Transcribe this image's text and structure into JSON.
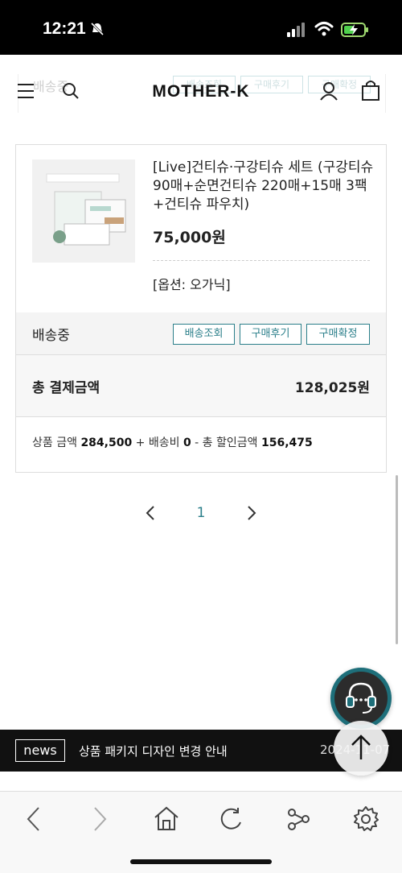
{
  "status_bar": {
    "time": "12:21"
  },
  "header": {
    "logo": "MOTHER-K",
    "ghost_shipping_label": "배송중",
    "ghost_buttons": [
      "배송조회",
      "구매후기",
      "구매확정"
    ]
  },
  "order": {
    "product_name": "[Live]건티슈·구강티슈 세트 (구강티슈 90매+순면건티슈 220매+15매 3팩+건티슈 파우치)",
    "price": "75,000원",
    "option": "[옵션: 오가닉]",
    "shipping_status": "배송중",
    "buttons": {
      "track": "배송조회",
      "review": "구매후기",
      "confirm": "구매확정"
    },
    "total_label": "총 결제금액",
    "total_value": "128,025원",
    "breakdown": {
      "product_label": "상품 금액",
      "product_value": "284,500",
      "plus": "+",
      "shipping_label": "배송비",
      "shipping_value": "0",
      "minus": "-",
      "discount_label": "총 할인금액",
      "discount_value": "156,475"
    }
  },
  "pagination": {
    "current": "1"
  },
  "news": {
    "badge": "news",
    "text": "상품 패키지 디자인 변경 안내",
    "date": "2024-11-07"
  },
  "colors": {
    "accent": "#2b7f8a",
    "news_bg": "#111111",
    "status_bar": "#000000"
  },
  "icons": [
    "menu-icon",
    "search-icon",
    "user-icon",
    "bag-icon",
    "headset-icon",
    "arrow-up-icon",
    "back-icon",
    "forward-icon",
    "home-icon",
    "reload-icon",
    "share-icon",
    "settings-icon"
  ]
}
